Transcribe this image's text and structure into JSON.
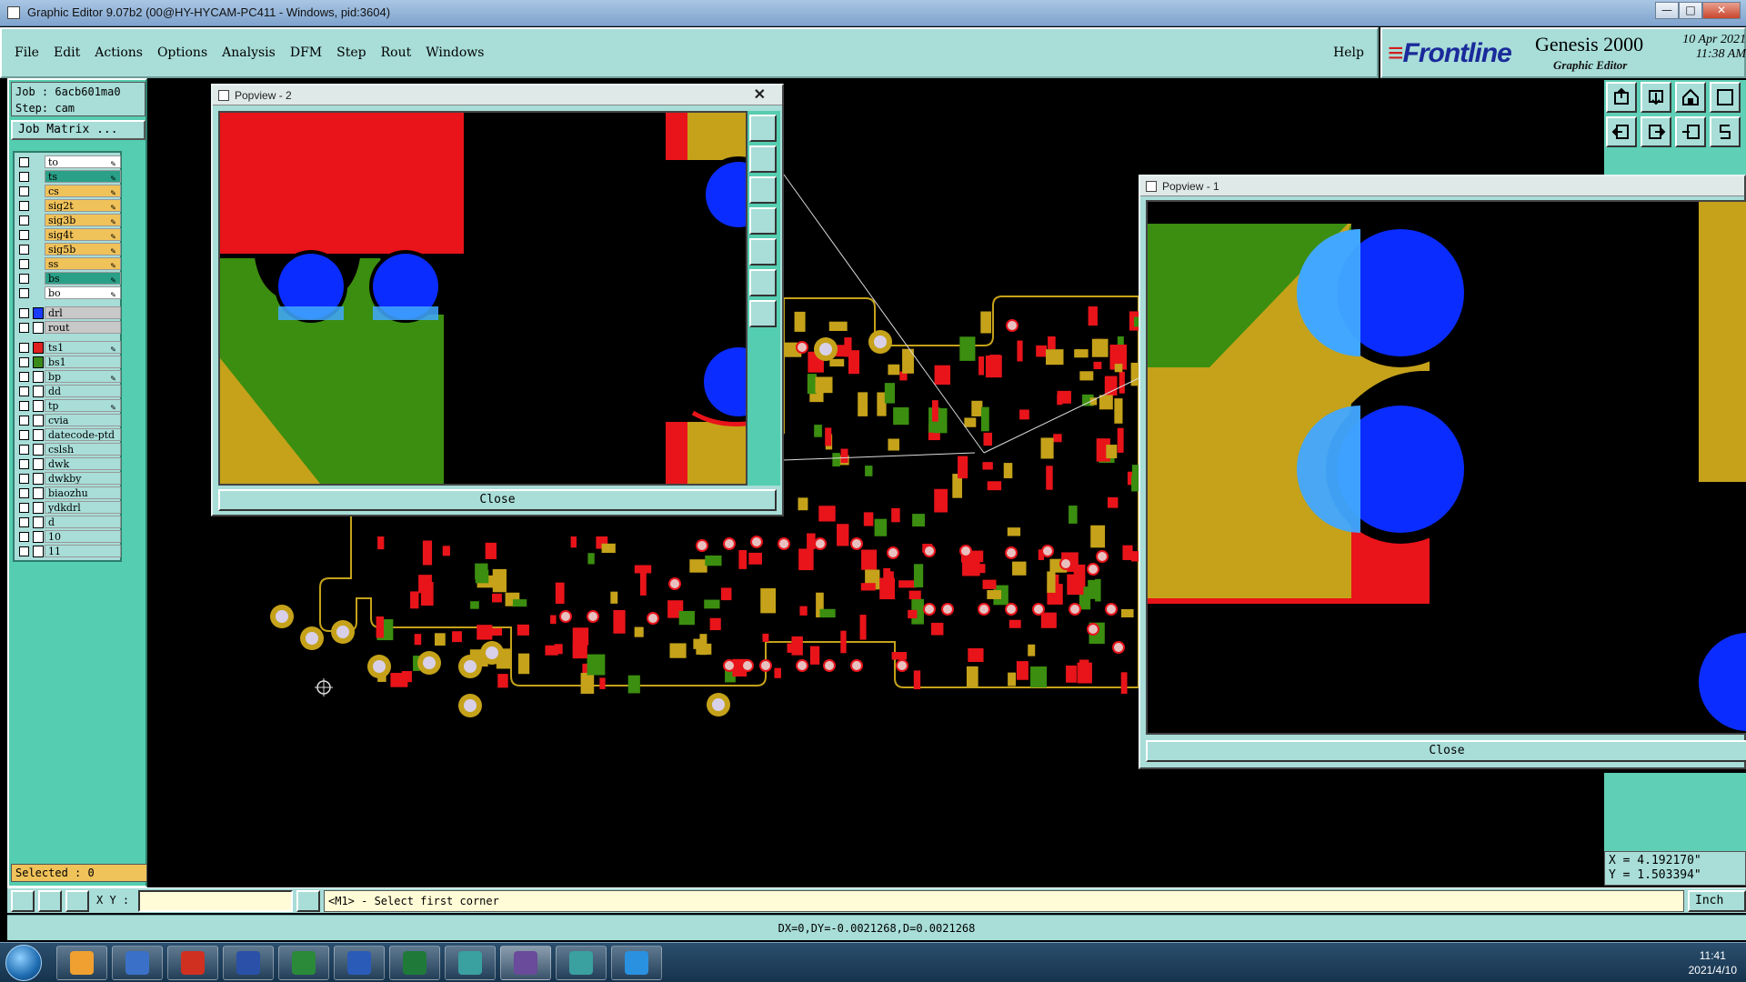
{
  "window": {
    "title": "Graphic Editor 9.07b2 (00@HY-HYCAM-PC411 - Windows, pid:3604)"
  },
  "menu": {
    "items": [
      "File",
      "Edit",
      "Actions",
      "Options",
      "Analysis",
      "DFM",
      "Step",
      "Rout",
      "Windows"
    ],
    "help": "Help"
  },
  "brand": {
    "logo": "Frontline",
    "product": "Genesis 2000",
    "subtitle": "Graphic Editor",
    "date": "10 Apr 2021",
    "time": "11:38 AM"
  },
  "job": {
    "job": "Job : 6acb601ma0",
    "step": "Step: cam",
    "matrix_button": "Job Matrix ..."
  },
  "layers": [
    {
      "name": "to",
      "color": "#ffffff",
      "edit": true
    },
    {
      "name": "ts",
      "color": "#2aa088",
      "edit": true
    },
    {
      "name": "cs",
      "color": "#f0c25a",
      "edit": true
    },
    {
      "name": "sig2t",
      "color": "#f0c25a",
      "edit": true
    },
    {
      "name": "sig3b",
      "color": "#f0c25a",
      "edit": true
    },
    {
      "name": "sig4t",
      "color": "#f0c25a",
      "edit": true
    },
    {
      "name": "sig5b",
      "color": "#f0c25a",
      "edit": true
    },
    {
      "name": "ss",
      "color": "#f0c25a",
      "edit": true
    },
    {
      "name": "bs",
      "color": "#2aa088",
      "edit": true
    },
    {
      "name": "bo",
      "color": "#ffffff",
      "edit": true
    }
  ],
  "drill_layers": [
    {
      "name": "drl",
      "swatch": "#1a3cff",
      "color": "#c8c8c8"
    },
    {
      "name": "rout",
      "swatch": "#ffffff",
      "color": "#c8c8c8"
    }
  ],
  "other_layers": [
    {
      "name": "ts1",
      "swatch": "#e02020",
      "edit": true
    },
    {
      "name": "bs1",
      "swatch": "#3a8a1a",
      "edit": false
    },
    {
      "name": "bp",
      "swatch": "#ffffff",
      "edit": true
    },
    {
      "name": "dd",
      "swatch": "#ffffff",
      "edit": false
    },
    {
      "name": "tp",
      "swatch": "#ffffff",
      "edit": true
    },
    {
      "name": "cvia",
      "swatch": "#ffffff",
      "edit": false
    },
    {
      "name": "datecode-ptd",
      "swatch": "#ffffff",
      "edit": false
    },
    {
      "name": "cslsh",
      "swatch": "#ffffff",
      "edit": false
    },
    {
      "name": "dwk",
      "swatch": "#ffffff",
      "edit": false
    },
    {
      "name": "dwkby",
      "swatch": "#ffffff",
      "edit": false
    },
    {
      "name": "biaozhu",
      "swatch": "#ffffff",
      "edit": false
    },
    {
      "name": "ydkdrl",
      "swatch": "#ffffff",
      "edit": false
    },
    {
      "name": "d",
      "swatch": "#ffffff",
      "edit": false
    },
    {
      "name": "10",
      "swatch": "#ffffff",
      "edit": false
    },
    {
      "name": "11",
      "swatch": "#ffffff",
      "edit": false
    }
  ],
  "selected": "Selected : 0",
  "coords": {
    "x": "X = 4.192170\"",
    "y": "Y = 1.503394\""
  },
  "bottom": {
    "xy_label": "X Y :",
    "xy_value": "",
    "prompt": "<M1> - Select first corner",
    "units": "Inch"
  },
  "status": "DX=0,DY=-0.0021268,D=0.0021268",
  "popup1": {
    "title": "Popview - 1",
    "close": "Close"
  },
  "popup2": {
    "title": "Popview - 2",
    "close": "Close"
  },
  "taskbar": {
    "time": "11:41",
    "date": "2021/4/10"
  },
  "colors": {
    "red": "#e8141a",
    "green": "#3b8e10",
    "gold": "#c5a21a",
    "blue": "#0b2cff",
    "lightblue": "#42a8ff",
    "panel": "#a8ddd8",
    "teal": "#55cdb0"
  }
}
